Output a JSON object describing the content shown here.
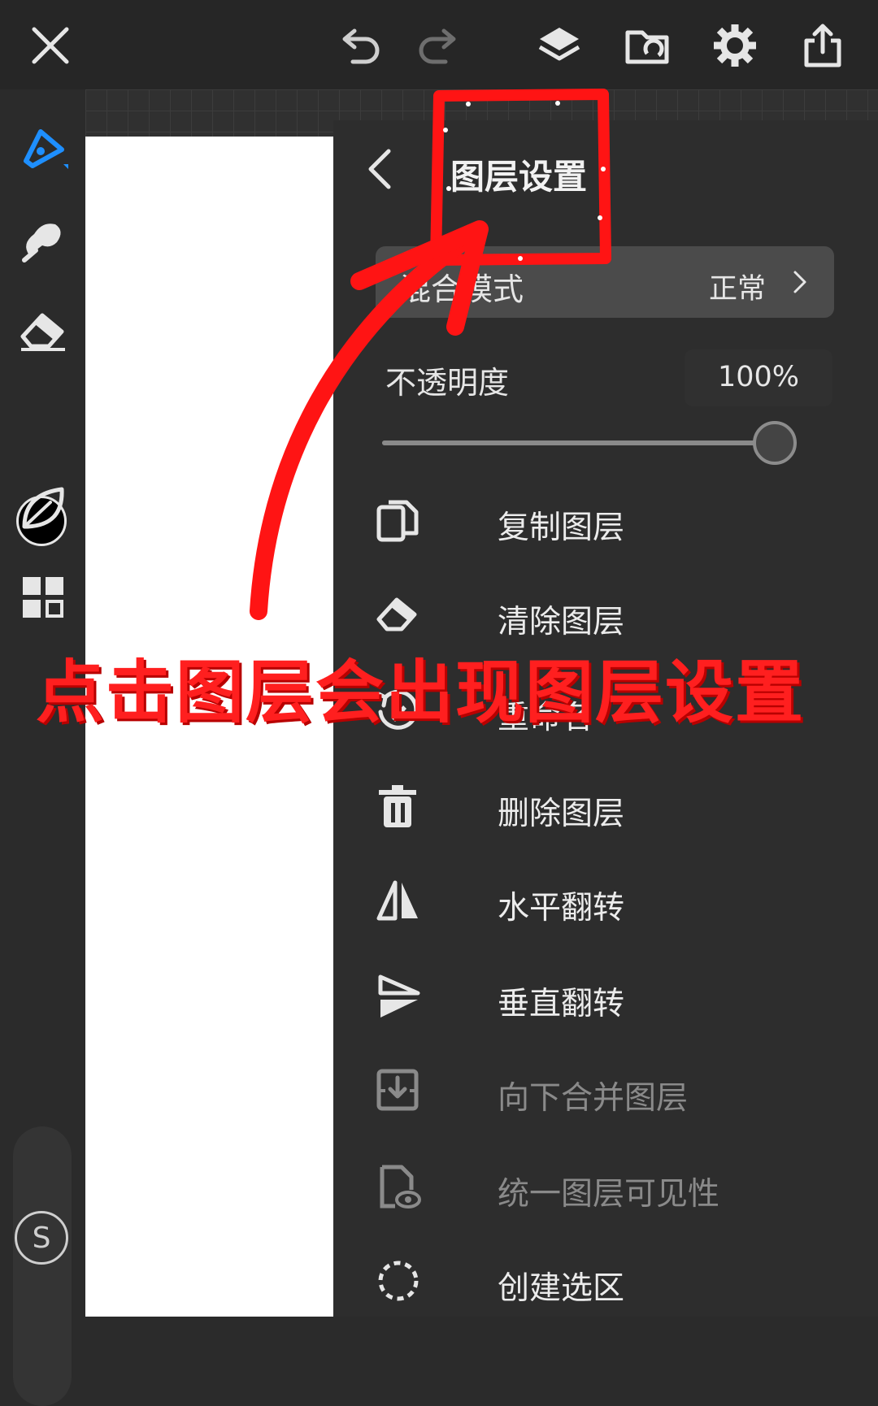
{
  "topbar": {
    "close_icon": "close-icon",
    "undo_icon": "undo-icon",
    "redo_icon": "redo-icon",
    "layers_icon": "layers-icon",
    "import_icon": "folder-import-icon",
    "settings_icon": "gear-icon",
    "share_icon": "share-icon"
  },
  "toolbar": {
    "tools": [
      "pen-tool-icon",
      "smudge-tool-icon",
      "eraser-tool-icon",
      "color-swatch",
      "leaf-tool-icon",
      "grid-tool-icon"
    ],
    "current_color": "#000000",
    "s_label": "S"
  },
  "panel": {
    "title": "图层设置",
    "blend": {
      "label": "混合模式",
      "value": "正常"
    },
    "opacity": {
      "label": "不透明度",
      "value": "100%",
      "level": 1.0
    },
    "menu": [
      {
        "label": "复制图层",
        "icon": "duplicate-icon",
        "enabled": true
      },
      {
        "label": "清除图层",
        "icon": "clear-icon",
        "enabled": true
      },
      {
        "label": "重命名",
        "icon": "rename-icon",
        "enabled": true
      },
      {
        "label": "删除图层",
        "icon": "trash-icon",
        "enabled": true
      },
      {
        "label": "水平翻转",
        "icon": "flip-horizontal-icon",
        "enabled": true
      },
      {
        "label": "垂直翻转",
        "icon": "flip-vertical-icon",
        "enabled": true
      },
      {
        "label": "向下合并图层",
        "icon": "merge-down-icon",
        "enabled": false
      },
      {
        "label": "统一图层可见性",
        "icon": "visibility-icon",
        "enabled": false
      },
      {
        "label": "创建选区",
        "icon": "selection-icon",
        "enabled": true
      }
    ]
  },
  "annotation": {
    "text": "点击图层会出现图层设置",
    "color": "#ff1f1f"
  }
}
